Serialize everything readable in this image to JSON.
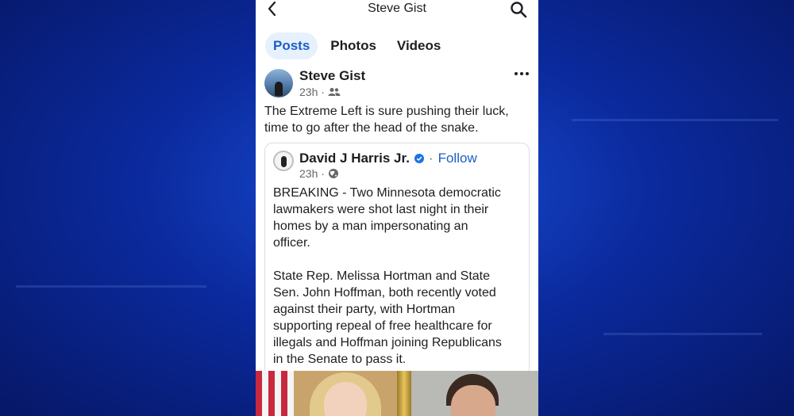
{
  "header": {
    "title": "Steve Gist"
  },
  "tabs": [
    {
      "label": "Posts",
      "active": true
    },
    {
      "label": "Photos",
      "active": false
    },
    {
      "label": "Videos",
      "active": false
    }
  ],
  "post": {
    "author": "Steve Gist",
    "time": "23h ·",
    "text": "The Extreme Left is sure pushing their luck,\ntime to go after the head of the snake.",
    "audience_icon": "friends-icon"
  },
  "shared_post": {
    "author": "David J Harris Jr.",
    "separator": "·",
    "follow_label": "Follow",
    "time": "23h ·",
    "audience_icon": "globe-icon",
    "text": "BREAKING - Two Minnesota democratic\nlawmakers were shot last night in their\nhomes by a man impersonating an\nofficer.\n\nState Rep. Melissa Hortman and State\nSen. John Hoffman, both recently voted\nagainst their party, with Hortman\nsupporting repeal of free healthcare for\nillegals and Hoffman joining Republicans\nin the Senate to pass it."
  },
  "colors": {
    "accent": "#1b5fc7",
    "tab_active_bg": "#e7f0fd",
    "background": "#0b2a9e"
  }
}
